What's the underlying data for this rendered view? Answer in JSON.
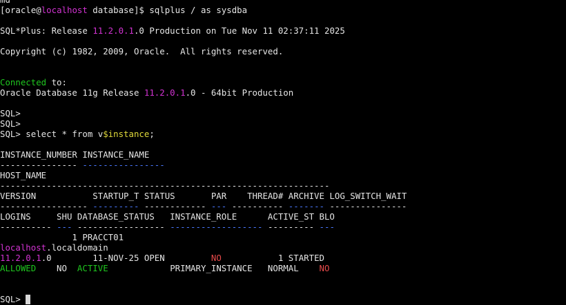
{
  "colors": {
    "background": "#000000",
    "default": "#e6e6e6",
    "magenta": "#d233d2",
    "green": "#1fc71f",
    "yellow": "#e0d93a",
    "red": "#e84a4a",
    "blue": "#4a78ff"
  },
  "lines": [
    [
      {
        "t": "md",
        "c": "default"
      }
    ],
    [
      {
        "t": "[oracle@",
        "c": "default"
      },
      {
        "t": "localhost",
        "c": "magenta"
      },
      {
        "t": " database]$ sqlplus / as sysdba",
        "c": "default"
      }
    ],
    [],
    [
      {
        "t": "SQL*Plus: Release ",
        "c": "default"
      },
      {
        "t": "11.2.0.1",
        "c": "magenta"
      },
      {
        "t": ".0 Production on Tue Nov 11 02:37:11 2025",
        "c": "default"
      }
    ],
    [],
    [
      {
        "t": "Copyright (c) 1982, 2009, Oracle.  All rights reserved.",
        "c": "default"
      }
    ],
    [],
    [],
    [
      {
        "t": "Connected",
        "c": "green"
      },
      {
        "t": " to:",
        "c": "default"
      }
    ],
    [
      {
        "t": "Oracle Database 11g Release ",
        "c": "default"
      },
      {
        "t": "11.2.0.1",
        "c": "magenta"
      },
      {
        "t": ".0 - 64bit Production",
        "c": "default"
      }
    ],
    [],
    [
      {
        "t": "SQL>",
        "c": "default"
      }
    ],
    [
      {
        "t": "SQL>",
        "c": "default"
      }
    ],
    [
      {
        "t": "SQL> select * from v",
        "c": "default"
      },
      {
        "t": "$instance",
        "c": "yellow"
      },
      {
        "t": ";",
        "c": "default"
      }
    ],
    [],
    [
      {
        "t": "INSTANCE_NUMBER INSTANCE_NAME",
        "c": "default"
      }
    ],
    [
      {
        "t": "--------------- ",
        "c": "default"
      },
      {
        "t": "----------------",
        "c": "blue"
      }
    ],
    [
      {
        "t": "HOST_NAME",
        "c": "default"
      }
    ],
    [
      {
        "t": "----------------------------------------------------------------",
        "c": "default"
      }
    ],
    [
      {
        "t": "VERSION           STARTUP_T STATUS       PAR    THREAD# ARCHIVE LOG_SWITCH_WAIT",
        "c": "default"
      }
    ],
    [
      {
        "t": "----------------- ",
        "c": "default"
      },
      {
        "t": "---------",
        "c": "blue"
      },
      {
        "t": " ------------ ",
        "c": "default"
      },
      {
        "t": "---",
        "c": "blue"
      },
      {
        "t": " ---------- ",
        "c": "default"
      },
      {
        "t": "-------",
        "c": "blue"
      },
      {
        "t": " ---------------",
        "c": "default"
      }
    ],
    [
      {
        "t": "LOGINS     SHU DATABASE_STATUS   INSTANCE_ROLE      ACTIVE_ST BLO",
        "c": "default"
      }
    ],
    [
      {
        "t": "---------- ",
        "c": "default"
      },
      {
        "t": "---",
        "c": "blue"
      },
      {
        "t": " ----------------- ",
        "c": "default"
      },
      {
        "t": "------------------",
        "c": "blue"
      },
      {
        "t": " --------- ",
        "c": "default"
      },
      {
        "t": "---",
        "c": "blue"
      }
    ],
    [
      {
        "t": "              1 PRACCT01",
        "c": "default"
      }
    ],
    [
      {
        "t": "localhost",
        "c": "magenta"
      },
      {
        "t": ".localdomain",
        "c": "default"
      }
    ],
    [
      {
        "t": "11.2.0.1",
        "c": "magenta"
      },
      {
        "t": ".0        11-NOV-25 OPEN         ",
        "c": "default"
      },
      {
        "t": "NO",
        "c": "red"
      },
      {
        "t": "           1 STARTED",
        "c": "default"
      }
    ],
    [
      {
        "t": "ALLOWED",
        "c": "green"
      },
      {
        "t": "    NO  ",
        "c": "default"
      },
      {
        "t": "ACTIVE",
        "c": "green"
      },
      {
        "t": "            PRIMARY_INSTANCE   NORMAL    ",
        "c": "default"
      },
      {
        "t": "NO",
        "c": "red"
      }
    ],
    [],
    [],
    [
      {
        "t": "SQL> ",
        "c": "default"
      }
    ]
  ]
}
